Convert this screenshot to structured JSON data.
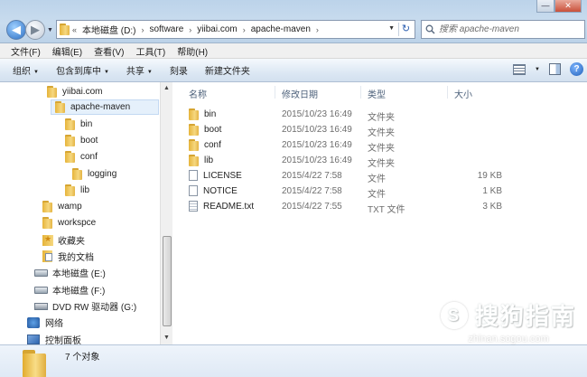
{
  "window": {
    "min_label": "—",
    "close_label": "✕"
  },
  "nav": {
    "back_glyph": "◀",
    "forward_glyph": "▶",
    "recent_glyph": "▼"
  },
  "address": {
    "overflow": "«",
    "crumbs": [
      "本地磁盘 (D:)",
      "software",
      "yiibai.com",
      "apache-maven"
    ],
    "separator": "›",
    "dropdown_glyph": "▼",
    "refresh_glyph": "↻"
  },
  "search": {
    "placeholder": "搜索 apache-maven"
  },
  "menu": [
    "文件(F)",
    "编辑(E)",
    "查看(V)",
    "工具(T)",
    "帮助(H)"
  ],
  "commands": {
    "organize": "组织",
    "include": "包含到库中",
    "share": "共享",
    "burn": "刻录",
    "new_folder": "新建文件夹",
    "arrow": "▼"
  },
  "tree": [
    {
      "label": "yiibai.com",
      "icon": "folder-icon"
    },
    {
      "label": "apache-maven",
      "icon": "folder-icon",
      "selected": true
    },
    {
      "label": "bin",
      "icon": "folder-icon"
    },
    {
      "label": "boot",
      "icon": "folder-icon"
    },
    {
      "label": "conf",
      "icon": "folder-icon"
    },
    {
      "label": "logging",
      "icon": "folder-icon"
    },
    {
      "label": "lib",
      "icon": "folder-icon"
    },
    {
      "label": "wamp",
      "icon": "folder-icon"
    },
    {
      "label": "workspce",
      "icon": "folder-icon"
    },
    {
      "label": "收藏夹",
      "icon": "favorites-folder-icon"
    },
    {
      "label": "我的文档",
      "icon": "documents-folder-icon"
    },
    {
      "label": "本地磁盘 (E:)",
      "icon": "drive-icon"
    },
    {
      "label": "本地磁盘 (F:)",
      "icon": "drive-icon"
    },
    {
      "label": "DVD RW 驱动器 (G:)",
      "icon": "dvd-drive-icon"
    },
    {
      "label": "网络",
      "icon": "network-icon"
    },
    {
      "label": "控制面板",
      "icon": "control-panel-icon"
    }
  ],
  "columns": {
    "name": "名称",
    "date": "修改日期",
    "type": "类型",
    "size": "大小"
  },
  "files": [
    {
      "name": "bin",
      "date": "2015/10/23 16:49",
      "type": "文件夹",
      "size": "",
      "icon": "folder-icon"
    },
    {
      "name": "boot",
      "date": "2015/10/23 16:49",
      "type": "文件夹",
      "size": "",
      "icon": "folder-icon"
    },
    {
      "name": "conf",
      "date": "2015/10/23 16:49",
      "type": "文件夹",
      "size": "",
      "icon": "folder-icon"
    },
    {
      "name": "lib",
      "date": "2015/10/23 16:49",
      "type": "文件夹",
      "size": "",
      "icon": "folder-icon"
    },
    {
      "name": "LICENSE",
      "date": "2015/4/22 7:58",
      "type": "文件",
      "size": "19 KB",
      "icon": "file-icon"
    },
    {
      "name": "NOTICE",
      "date": "2015/4/22 7:58",
      "type": "文件",
      "size": "1 KB",
      "icon": "file-icon"
    },
    {
      "name": "README.txt",
      "date": "2015/4/22 7:55",
      "type": "TXT 文件",
      "size": "3 KB",
      "icon": "text-file-icon"
    }
  ],
  "details": {
    "count": "7 个对象"
  },
  "watermark": {
    "main": "搜狗指南",
    "sub": "zhinan.sogou.com",
    "logo": "S"
  }
}
